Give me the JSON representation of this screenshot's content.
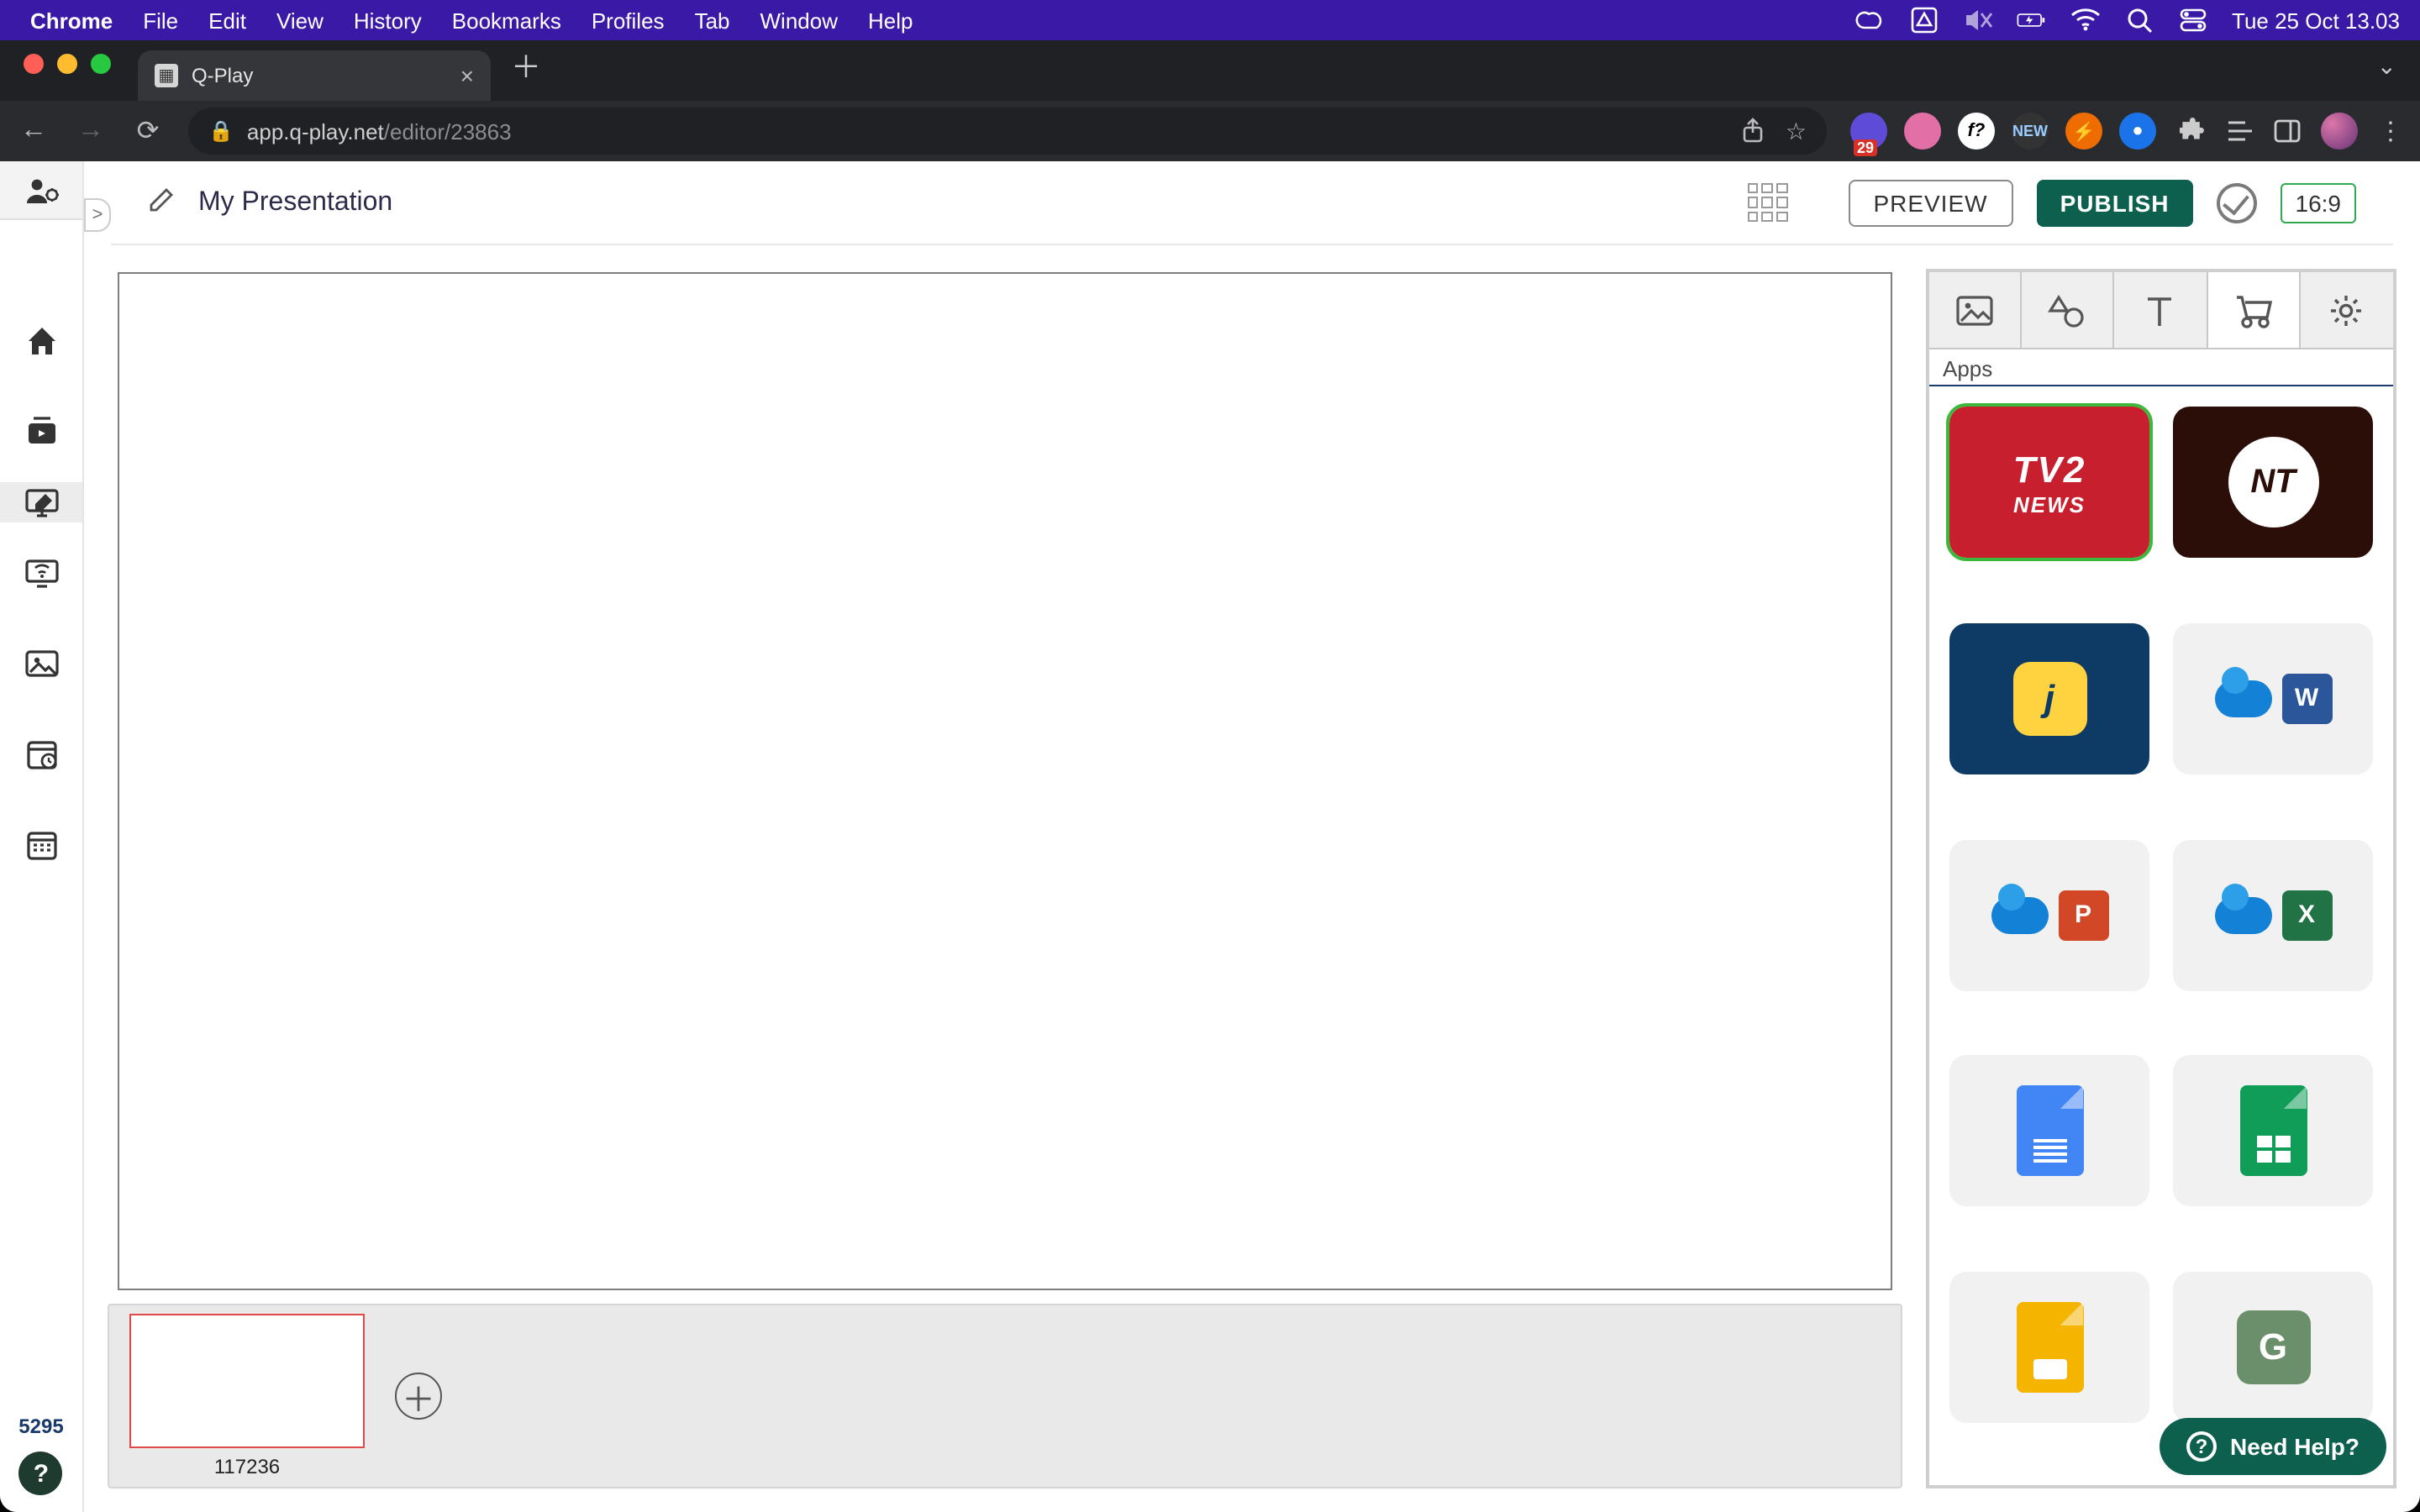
{
  "mac_menubar": {
    "app": "Chrome",
    "menus": [
      "File",
      "Edit",
      "View",
      "History",
      "Bookmarks",
      "Profiles",
      "Tab",
      "Window",
      "Help"
    ],
    "status": {
      "datetime": "Tue 25 Oct  13.03"
    }
  },
  "chrome": {
    "tab_title": "Q-Play",
    "url_host": "app.q-play.net",
    "url_path": "/editor/23863",
    "ext_badge_count": "29",
    "ext_new_label": "NEW"
  },
  "app": {
    "presentation_title": "My Presentation",
    "preview_label": "PREVIEW",
    "publish_label": "PUBLISH",
    "aspect_ratio": "16:9",
    "sidebar_footer_number": "5295",
    "slide_thumb_id": "117236",
    "collapse_chevron": ">",
    "right_panel_section": "Apps",
    "apps": [
      {
        "id": "tv2-news",
        "selected": true,
        "type": "tv2",
        "line1": "TV2",
        "line2": "NEWS"
      },
      {
        "id": "nt",
        "type": "nt",
        "label": "NT"
      },
      {
        "id": "j-app",
        "type": "j",
        "label": "j"
      },
      {
        "id": "onedrive-word",
        "type": "cloud-ms",
        "ms": "W"
      },
      {
        "id": "onedrive-ppt",
        "type": "cloud-ms",
        "ms": "P"
      },
      {
        "id": "onedrive-excel",
        "type": "cloud-ms",
        "ms": "X"
      },
      {
        "id": "google-docs",
        "type": "gdoc-blue"
      },
      {
        "id": "google-sheets",
        "type": "gdoc-green"
      },
      {
        "id": "google-slides",
        "type": "gdoc-yellow"
      },
      {
        "id": "g-form",
        "type": "gform",
        "label": "G"
      }
    ],
    "need_help_label": "Need Help?"
  }
}
